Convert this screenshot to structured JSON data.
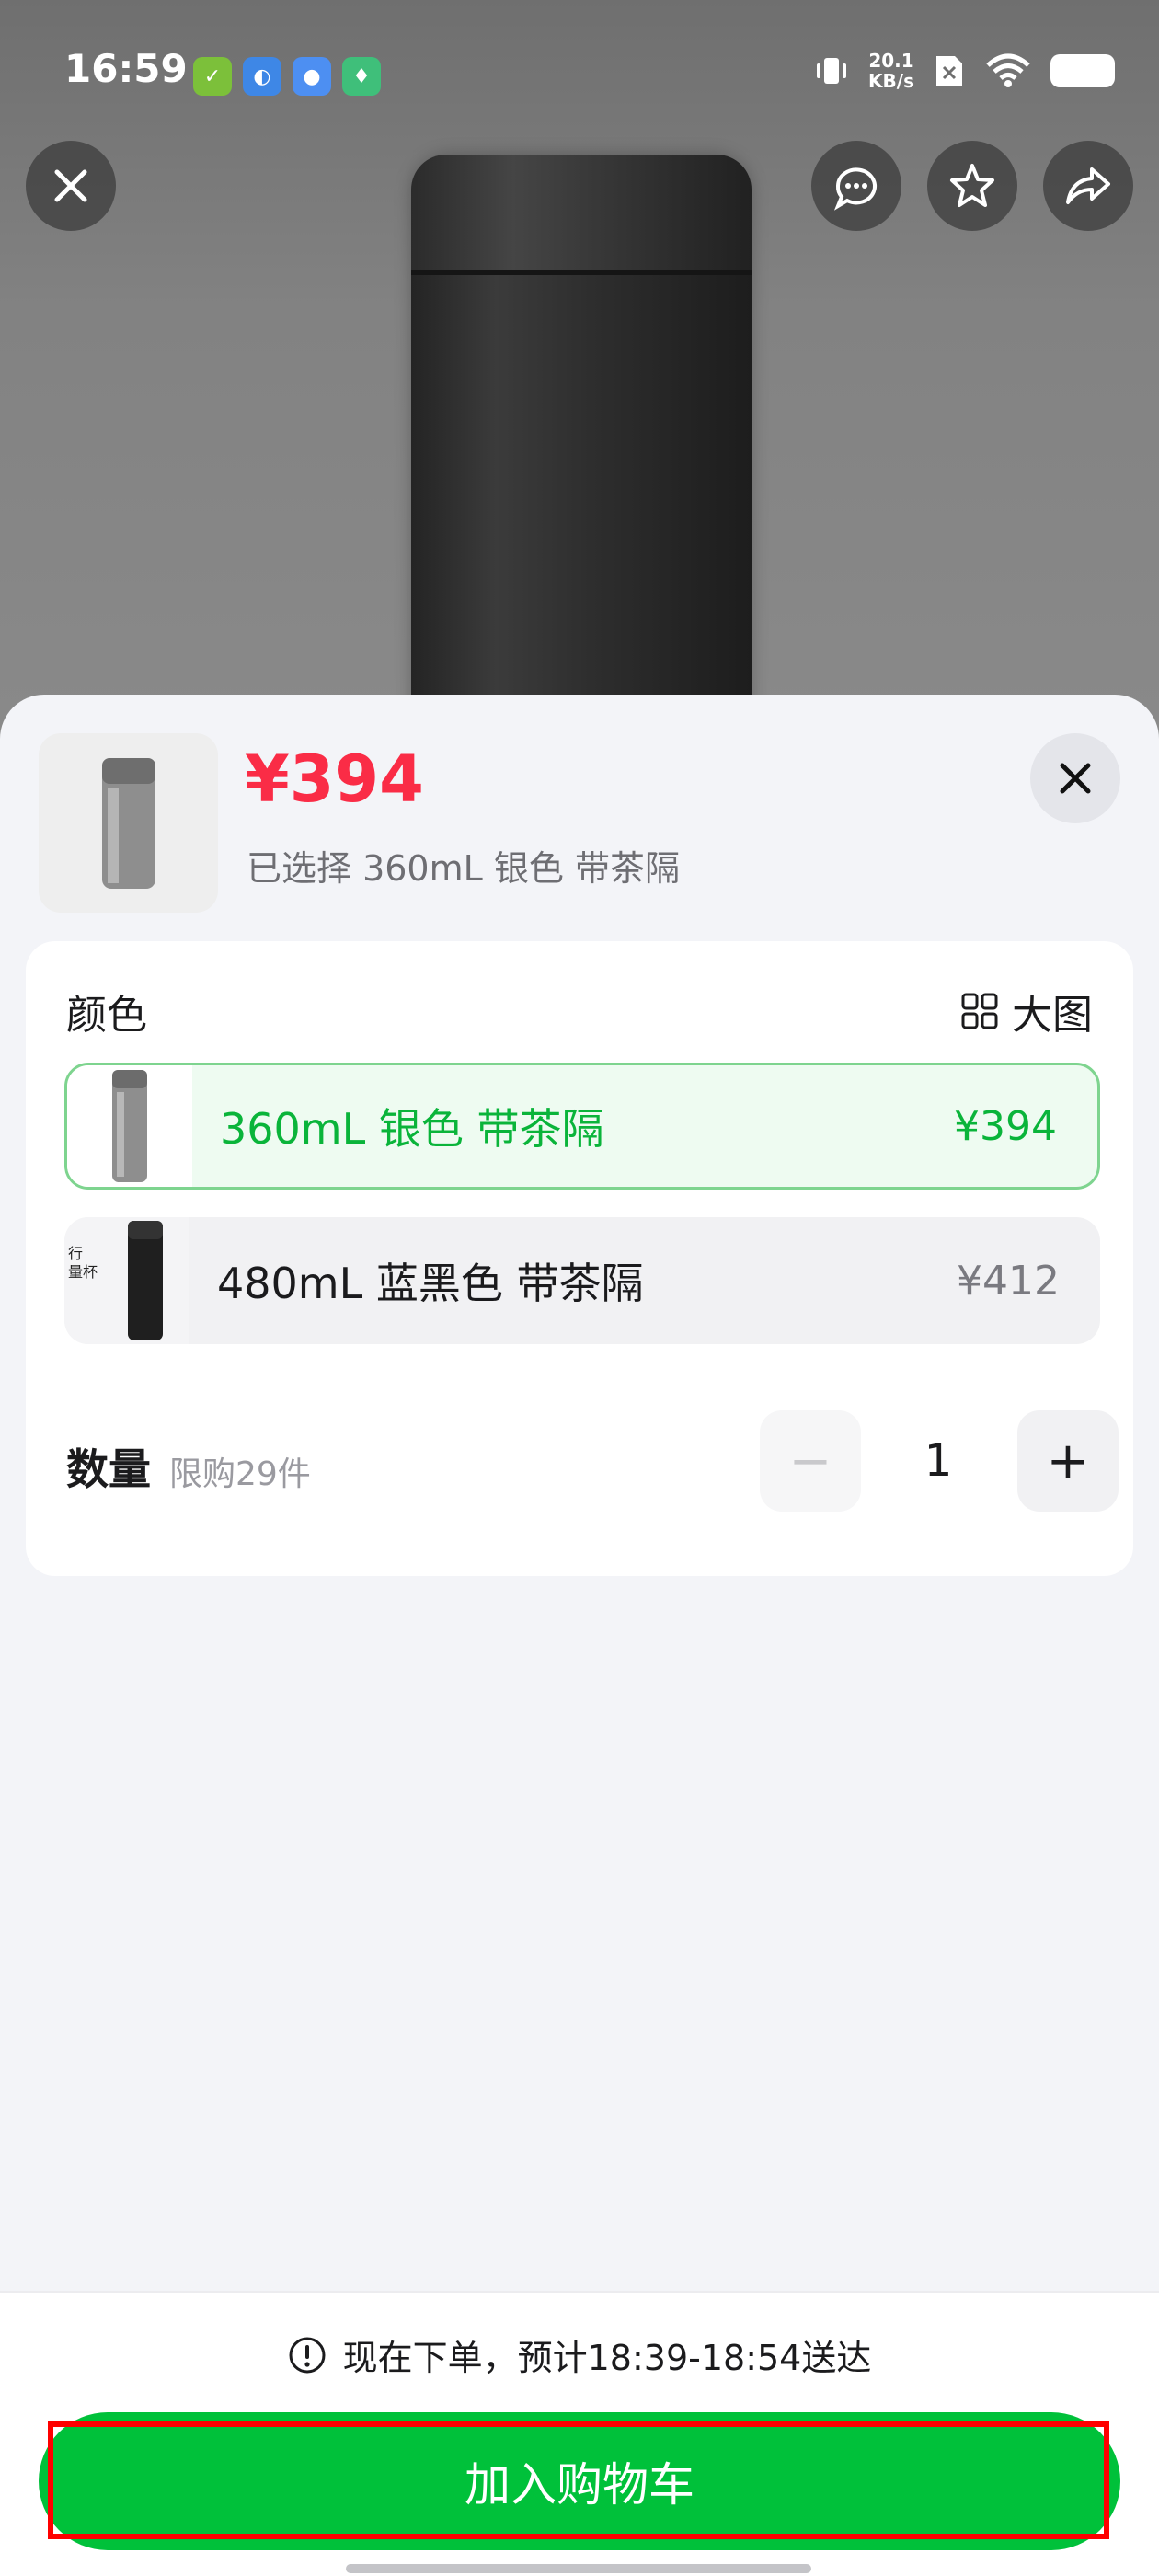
{
  "status_bar": {
    "time": "16:59",
    "net_speed_value": "20.1",
    "net_speed_unit": "KB/s"
  },
  "sheet": {
    "price": "¥394",
    "selected_summary": "已选择 360mL 银色 带茶隔"
  },
  "color_section": {
    "title": "颜色",
    "big_image_label": "大图",
    "options": [
      {
        "label": "360mL 银色 带茶隔",
        "price": "¥394",
        "selected": true
      },
      {
        "label": "480mL 蓝黑色 带茶隔",
        "price": "¥412",
        "selected": false
      }
    ],
    "option2_thumb_text": [
      "行",
      "量杯"
    ]
  },
  "quantity": {
    "label": "数量",
    "limit": "限购29件",
    "value": "1",
    "minus": "−",
    "plus": "+"
  },
  "footer": {
    "delivery": "现在下单，预计18:39-18:54送达",
    "add_to_cart": "加入购物车"
  },
  "colors": {
    "accent_green": "#00c13a",
    "price_red": "#fa2c46",
    "highlight_red": "#ff0000"
  }
}
